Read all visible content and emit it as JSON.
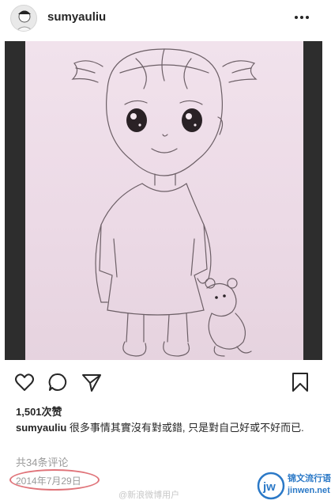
{
  "header": {
    "username": "sumyauliu",
    "avatar_icon": "avatar-icon",
    "more_icon": "more-options-icon"
  },
  "post": {
    "image_description_icon": "pencil-sketch-girl-with-teddy-bear"
  },
  "actions": {
    "like_icon": "heart-icon",
    "comment_icon": "comment-icon",
    "share_icon": "paper-plane-icon",
    "save_icon": "bookmark-icon"
  },
  "likes": "1,501次赞",
  "caption": {
    "username": "sumyauliu",
    "text": "很多事情其實沒有對或錯, 只是對自己好或不好而已."
  },
  "comments": "共34条评论",
  "date": "2014年7月29日",
  "watermark": {
    "weibo": "@新浪微博用户",
    "site_name": "锦文流行语",
    "site_url": "jinwen.net"
  },
  "colors": {
    "date_circle": "#e0747a",
    "site_blue": "#2b79c7"
  }
}
